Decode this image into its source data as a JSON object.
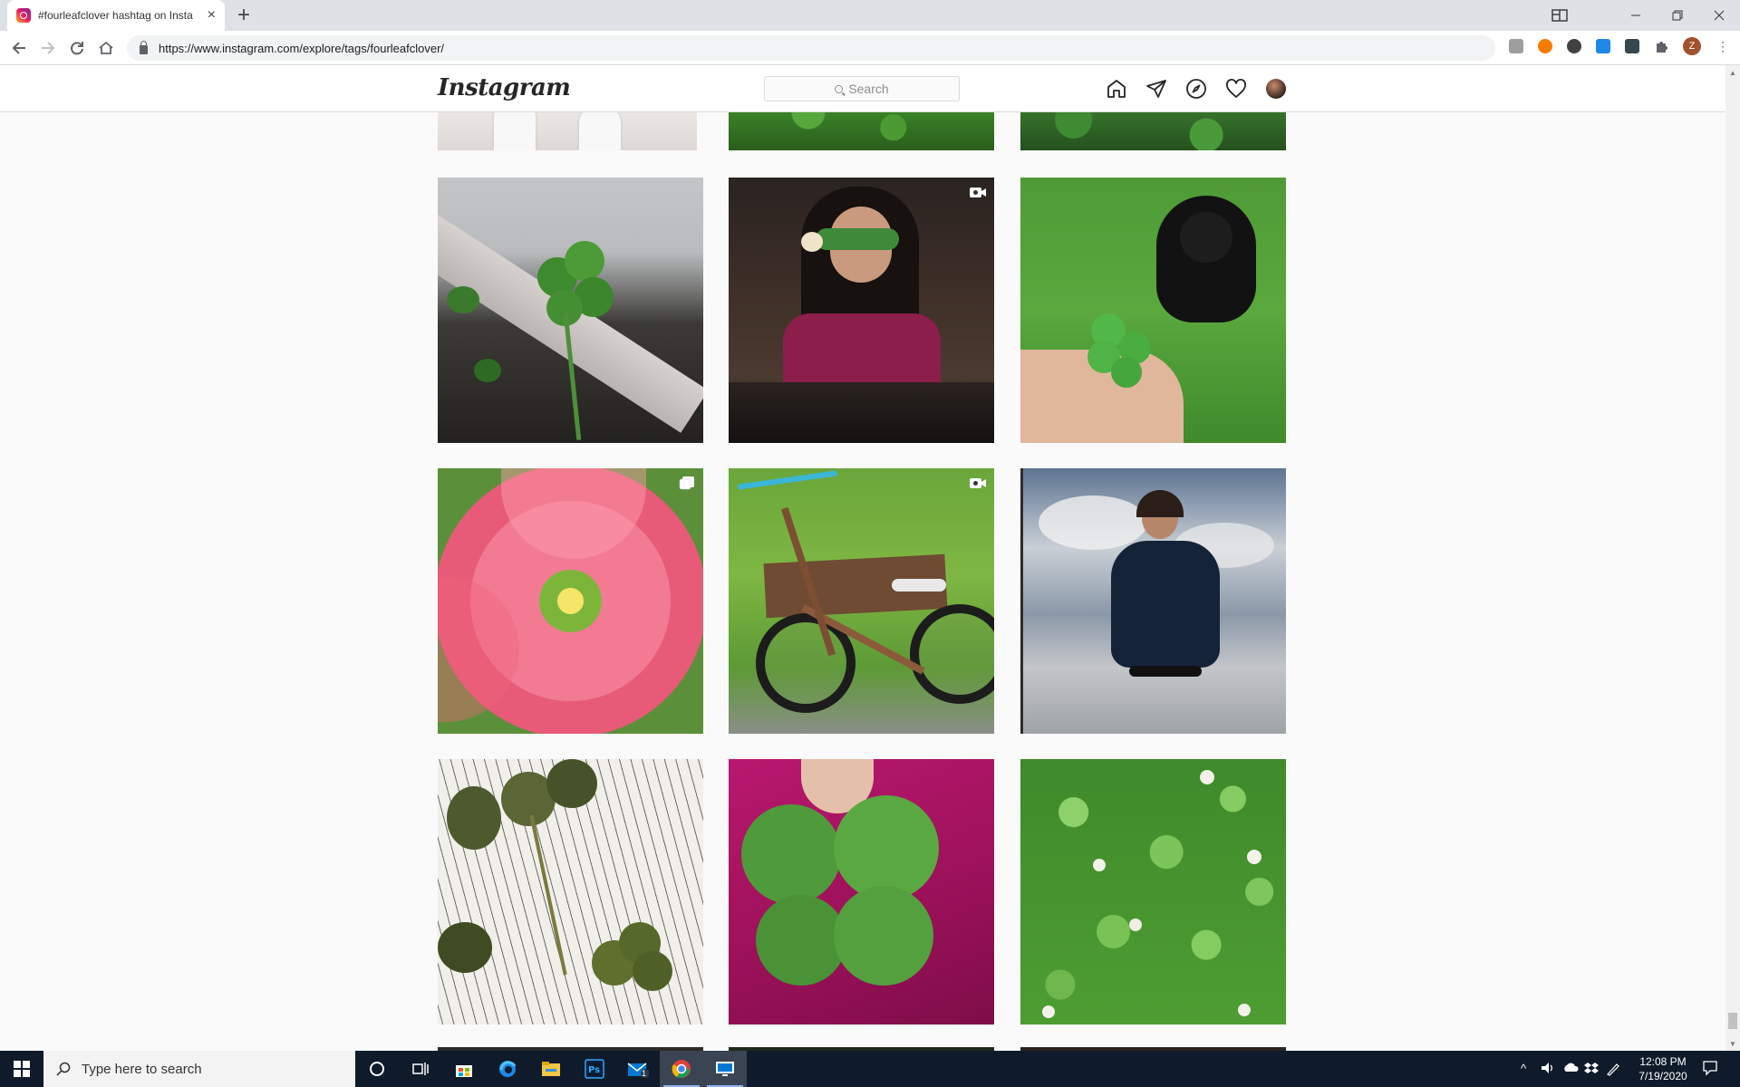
{
  "browser": {
    "tab_title": "#fourleafclover hashtag on Insta",
    "tab_close_label": "×",
    "new_tab_label": "+",
    "url": "https://www.instagram.com/explore/tags/fourleafclover/",
    "profile_initial": "Z"
  },
  "instagram": {
    "logo_text": "Instagram",
    "search_placeholder": "Search",
    "nav_icons": [
      "home-icon",
      "direct-message-icon",
      "explore-icon",
      "activity-heart-icon",
      "profile-avatar"
    ]
  },
  "grid": {
    "rows": [
      {
        "row_index": 0,
        "partial": true,
        "items": [
          {
            "subject": "feet in white sneakers",
            "badge": null
          },
          {
            "subject": "clover patch",
            "badge": null
          },
          {
            "subject": "clover leaves",
            "badge": null
          }
        ]
      },
      {
        "row_index": 1,
        "partial": false,
        "items": [
          {
            "subject": "four leaf clover by planter",
            "badge": null
          },
          {
            "subject": "woman holding leaf",
            "badge": "video"
          },
          {
            "subject": "hand holding clover with black dog",
            "badge": null
          }
        ]
      },
      {
        "row_index": 2,
        "partial": false,
        "items": [
          {
            "subject": "pink oxalis flower",
            "badge": "carousel"
          },
          {
            "subject": "bicycle on grass",
            "badge": "video"
          },
          {
            "subject": "girl posing under cloudy sky",
            "badge": null
          }
        ]
      },
      {
        "row_index": 3,
        "partial": false,
        "items": [
          {
            "subject": "pressed clovers on book page",
            "badge": null
          },
          {
            "subject": "clover held over magenta fabric",
            "badge": null
          },
          {
            "subject": "clover field with white flowers",
            "badge": null
          }
        ]
      }
    ]
  },
  "taskbar": {
    "search_placeholder": "Type here to search",
    "time": "12:08 PM",
    "date": "7/19/2020",
    "mail_badge": "1"
  },
  "colors": {
    "ig_border": "#dbdbdb",
    "ig_bg": "#fafafa",
    "taskbar_bg": "#0f1b2b"
  }
}
